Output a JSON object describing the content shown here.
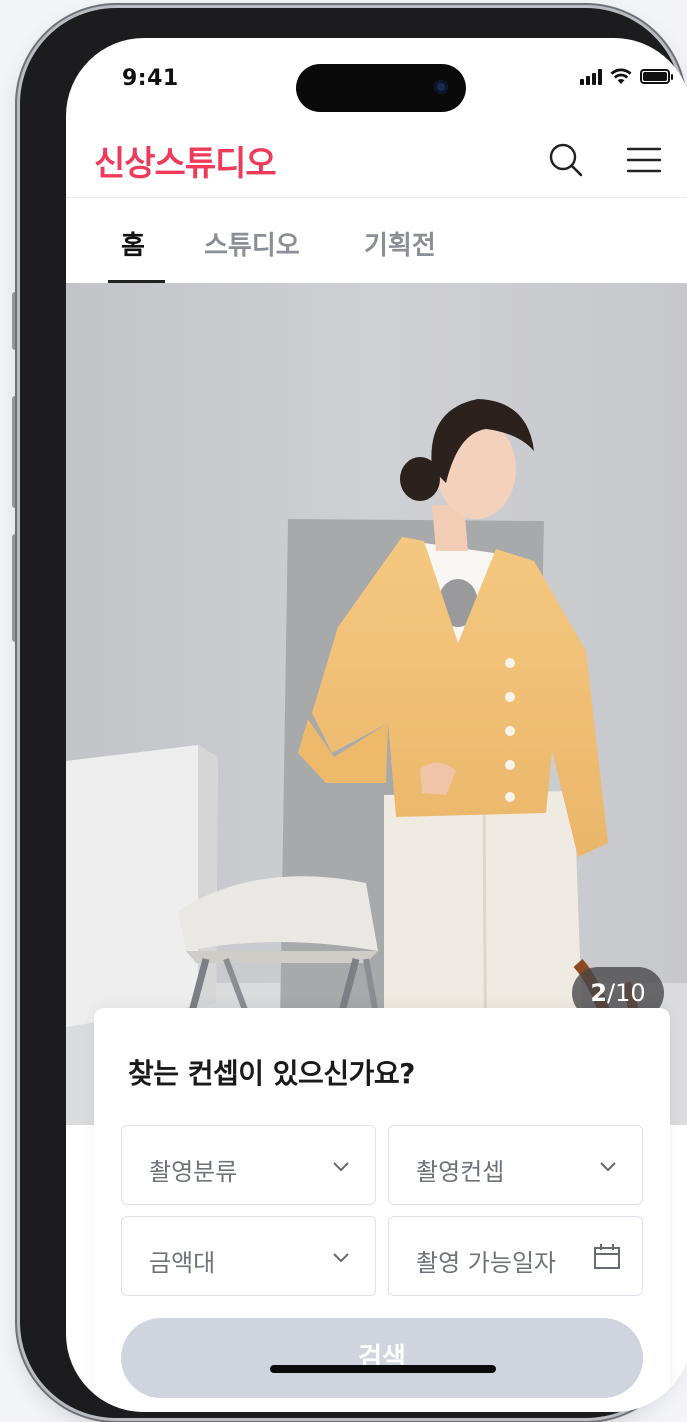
{
  "status_bar": {
    "time": "9:41",
    "icons": [
      "cellular-signal-icon",
      "wifi-icon",
      "battery-icon"
    ],
    "battery_level": 1.0
  },
  "header": {
    "brand": "신상스튜디오",
    "brand_color": "#f03a5a",
    "icons": [
      "search-icon",
      "hamburger-menu-icon"
    ]
  },
  "tabs": [
    {
      "label": "홈",
      "active": true
    },
    {
      "label": "스튜디오",
      "active": false
    },
    {
      "label": "기획전",
      "active": false
    }
  ],
  "carousel": {
    "current": "2",
    "separator": "/",
    "total": "10"
  },
  "search_card": {
    "title": "찾는 컨셉이 있으신가요?",
    "fields": [
      {
        "label": "촬영분류",
        "icon": "chevron-down-icon"
      },
      {
        "label": "촬영컨셉",
        "icon": "chevron-down-icon"
      },
      {
        "label": "금액대",
        "icon": "chevron-down-icon"
      },
      {
        "label": "촬영 가능일자",
        "icon": "calendar-icon"
      }
    ],
    "button_label": "검색",
    "button_color": "#cfd4df"
  }
}
